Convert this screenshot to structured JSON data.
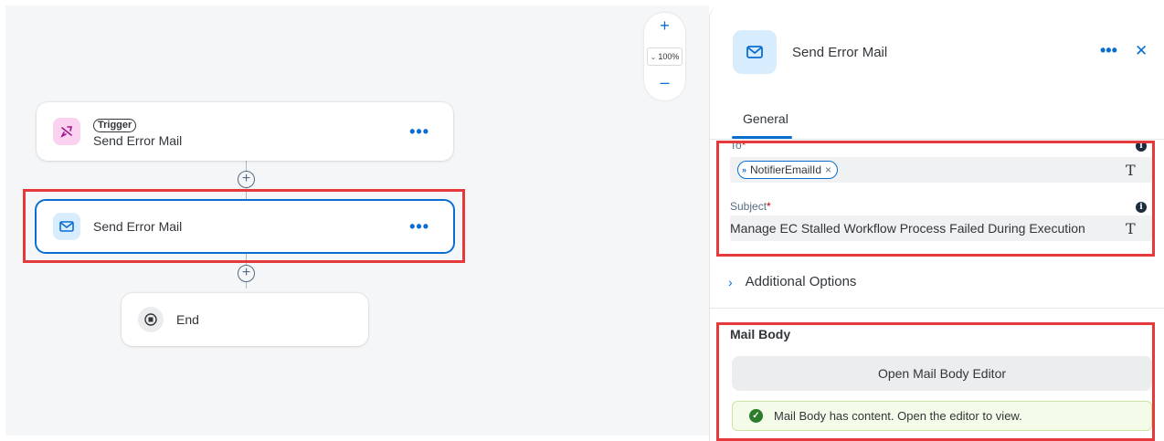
{
  "canvas": {
    "trigger_node": {
      "badge": "Trigger",
      "label": "Send Error Mail",
      "icon": "trigger-icon",
      "more": "•••"
    },
    "mail_node": {
      "label": "Send Error Mail",
      "icon": "mail-icon",
      "more": "•••"
    },
    "end_node": {
      "label": "End",
      "icon": "stop-icon"
    },
    "add_step_symbol": "+",
    "zoom": {
      "in": "+",
      "out": "–",
      "level": "100%",
      "chevron": "⌄"
    }
  },
  "panel": {
    "title": "Send Error Mail",
    "icon": "mail-icon",
    "more": "•••",
    "close": "✕",
    "tabs": [
      {
        "label": "General",
        "active": true
      }
    ],
    "to": {
      "label": "To",
      "required_mark": "*",
      "token": "NotifierEmailId",
      "token_prefix": "»",
      "token_remove": "×",
      "type_icon": "T"
    },
    "subject": {
      "label": "Subject",
      "required_mark": "*",
      "value": "Manage EC Stalled Workflow Process Failed During Execution",
      "type_icon": "T"
    },
    "additional_options": {
      "label": "Additional Options",
      "chevron": "›"
    },
    "mail_body": {
      "title": "Mail Body",
      "button": "Open Mail Body Editor",
      "message": "Mail Body has content. Open the editor to view.",
      "message_icon": "✓"
    }
  },
  "colors": {
    "accent": "#0a6ed1",
    "highlight": "#e5393b",
    "success": "#2b7c2b",
    "trigger_bg": "#fbd3f1",
    "mail_bg": "#d7ecfd"
  }
}
